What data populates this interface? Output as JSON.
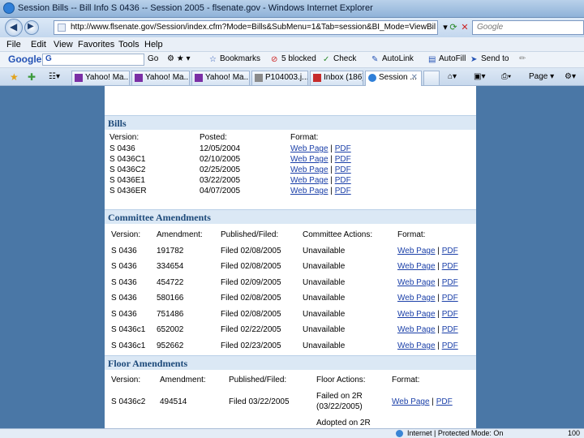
{
  "window": {
    "title": "Session Bills -- Bill Info S 0436 -- Session 2005 - flsenate.gov - Windows Internet Explorer"
  },
  "address": {
    "url": "http://www.flsenate.gov/Session/index.cfm?Mode=Bills&SubMenu=1&Tab=session&BI_Mode=ViewBillInfo&B",
    "search_placeholder": "Google"
  },
  "menu": [
    "File",
    "Edit",
    "View",
    "Favorites",
    "Tools",
    "Help"
  ],
  "google_toolbar": {
    "logo": "Google",
    "input_prefix": "G",
    "go": "Go",
    "bookmarks": "Bookmarks",
    "blocked": "5 blocked",
    "check": "Check",
    "autolink": "AutoLink",
    "autofill": "AutoFill",
    "send_to": "Send to"
  },
  "tabs": [
    {
      "label": "Yahoo! Ma..."
    },
    {
      "label": "Yahoo! Ma..."
    },
    {
      "label": "Yahoo! Ma..."
    },
    {
      "label": "P104003.j..."
    },
    {
      "label": "Inbox (186)..."
    },
    {
      "label": "Session ..."
    }
  ],
  "tab_tools": {
    "page": "Page"
  },
  "bills": {
    "heading": "Bills",
    "headers": {
      "version": "Version:",
      "posted": "Posted:",
      "format": "Format:"
    },
    "rows": [
      {
        "version": "S 0436",
        "posted": "12/05/2004"
      },
      {
        "version": "S 0436C1",
        "posted": "02/10/2005"
      },
      {
        "version": "S 0436C2",
        "posted": "02/25/2005"
      },
      {
        "version": "S 0436E1",
        "posted": "03/22/2005"
      },
      {
        "version": "S 0436ER",
        "posted": "04/07/2005"
      }
    ],
    "link_web": "Web Page",
    "link_pdf": "PDF"
  },
  "committee": {
    "heading": "Committee Amendments",
    "headers": {
      "version": "Version:",
      "amendment": "Amendment:",
      "published": "Published/Filed:",
      "actions": "Committee Actions:",
      "format": "Format:"
    },
    "rows": [
      {
        "version": "S 0436",
        "amendment": "191782",
        "published": "Filed 02/08/2005",
        "action": "Unavailable"
      },
      {
        "version": "S 0436",
        "amendment": "334654",
        "published": "Filed 02/08/2005",
        "action": "Unavailable"
      },
      {
        "version": "S 0436",
        "amendment": "454722",
        "published": "Filed 02/09/2005",
        "action": "Unavailable"
      },
      {
        "version": "S 0436",
        "amendment": "580166",
        "published": "Filed 02/08/2005",
        "action": "Unavailable"
      },
      {
        "version": "S 0436",
        "amendment": "751486",
        "published": "Filed 02/08/2005",
        "action": "Unavailable"
      },
      {
        "version": "S 0436c1",
        "amendment": "652002",
        "published": "Filed 02/22/2005",
        "action": "Unavailable"
      },
      {
        "version": "S 0436c1",
        "amendment": "952662",
        "published": "Filed 02/23/2005",
        "action": "Unavailable"
      }
    ],
    "link_web": "Web Page",
    "link_pdf": "PDF"
  },
  "floor": {
    "heading": "Floor Amendments",
    "headers": {
      "version": "Version:",
      "amendment": "Amendment:",
      "published": "Published/Filed:",
      "actions": "Floor Actions:",
      "format": "Format:"
    },
    "rows": [
      {
        "version": "S 0436c2",
        "amendment": "494514",
        "published": "Filed 03/22/2005",
        "action_line1": "Failed on 2R",
        "action_line2": "(03/22/2005)"
      }
    ],
    "partial_action": "Adopted on 2R",
    "link_web": "Web Page",
    "link_pdf": "PDF"
  },
  "status": {
    "zone": "Internet | Protected Mode: On",
    "zoom": "100"
  }
}
